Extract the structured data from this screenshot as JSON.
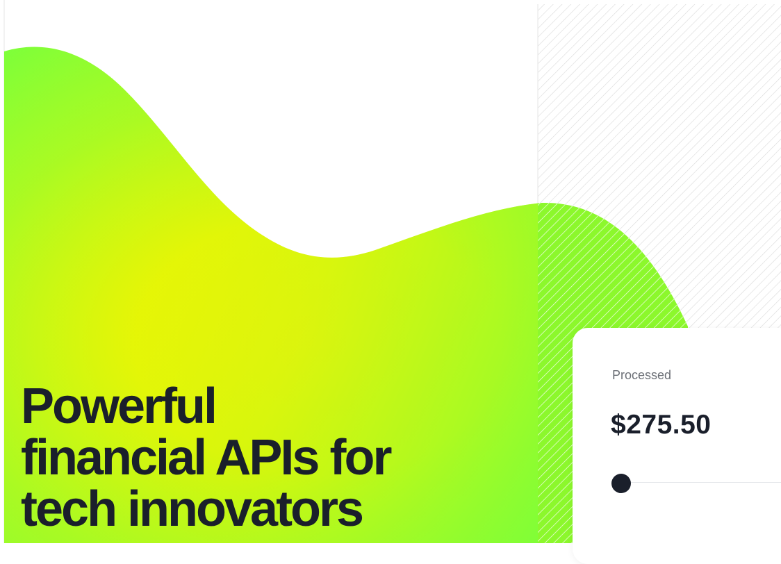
{
  "colors": {
    "blob_yellow": "#fff200",
    "blob_green": "#7cff3a",
    "text_dark": "#1a1f2b"
  },
  "hero": {
    "headline_lines": [
      "Powerful",
      "financial APIs for",
      "tech innovators"
    ]
  },
  "card": {
    "label": "Processed",
    "amount": "$275.50",
    "progress_fraction": 0.0
  }
}
